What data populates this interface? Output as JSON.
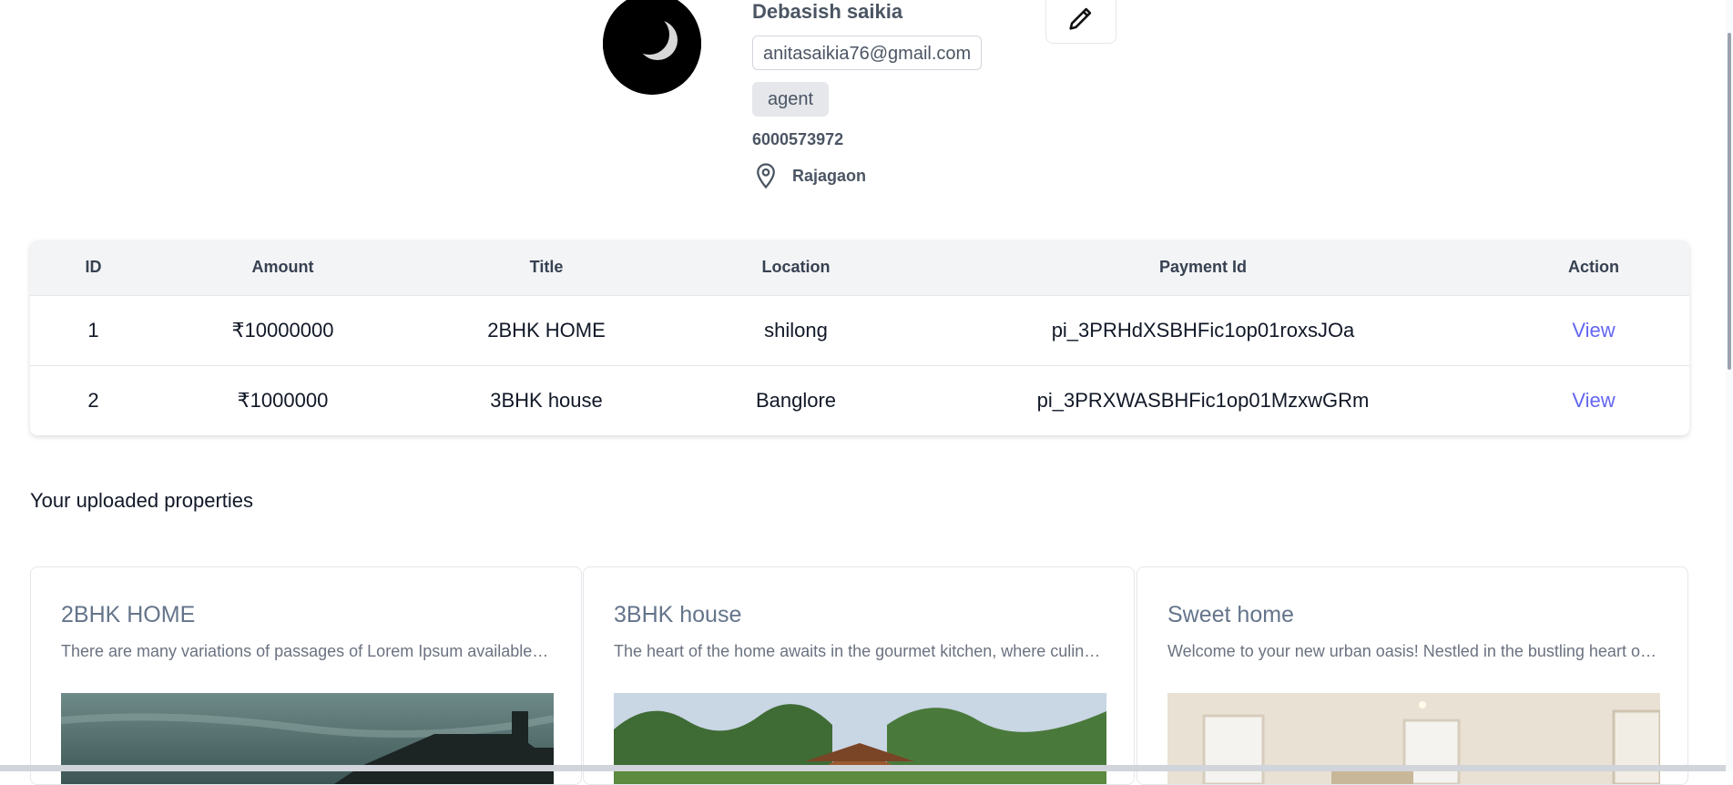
{
  "profile": {
    "name": "Debasish saikia",
    "email": "anitasaikia76@gmail.com",
    "role": "agent",
    "phone": "6000573972",
    "location": "Rajagaon",
    "avatar_icon": "moon-avatar",
    "edit_icon": "pencil-icon"
  },
  "payments": {
    "columns": [
      "ID",
      "Amount",
      "Title",
      "Location",
      "Payment Id",
      "Action"
    ],
    "rows": [
      {
        "id": "1",
        "amount": "₹10000000",
        "title": "2BHK HOME",
        "location": "shilong",
        "payment_id": "pi_3PRHdXSBHFic1op01roxsJOa",
        "action": "View"
      },
      {
        "id": "2",
        "amount": "₹1000000",
        "title": "3BHK house",
        "location": "Banglore",
        "payment_id": "pi_3PRXWASBHFic1op01MzxwGRm",
        "action": "View"
      }
    ]
  },
  "properties": {
    "section_title": "Your uploaded properties",
    "cards": [
      {
        "title": "2BHK HOME",
        "description": "There are many variations of passages of Lorem Ipsum available, but the majority have suffered alteration"
      },
      {
        "title": "3BHK house",
        "description": "The heart of the home awaits in the gourmet kitchen, where culinary dreams come true"
      },
      {
        "title": "Sweet home",
        "description": "Welcome to your new urban oasis! Nestled in the bustling heart of the city"
      }
    ]
  },
  "colors": {
    "link": "#6366f1",
    "table_header_bg": "#f3f4f6",
    "muted_text": "#4b5563"
  }
}
